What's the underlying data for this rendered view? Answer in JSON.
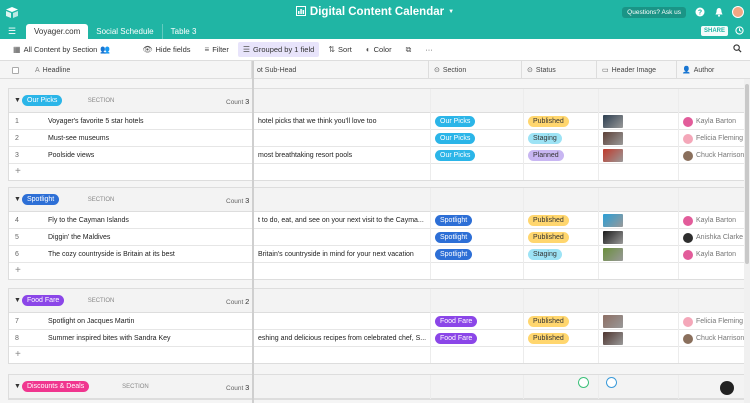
{
  "app": {
    "title": "Digital Content Calendar",
    "help_label": "Questions? Ask us",
    "share_label": "SHARE",
    "brand_color": "#20b5a4"
  },
  "tabs": [
    {
      "label": "Voyager.com",
      "active": true
    },
    {
      "label": "Social Schedule",
      "active": false
    },
    {
      "label": "Table 3",
      "active": false
    }
  ],
  "toolbar": {
    "view_label": "All Content by Section",
    "hide_fields": "Hide fields",
    "filter": "Filter",
    "grouped": "Grouped by 1 field",
    "sort": "Sort",
    "color": "Color",
    "more": "···"
  },
  "columns": {
    "headline": "Headline",
    "subhead": "ot Sub-Head",
    "section": "Section",
    "status": "Status",
    "header_image": "Header Image",
    "author": "Author"
  },
  "groups": [
    {
      "name": "Our Picks",
      "label": "SECTION",
      "count_label": "Count",
      "count": "3",
      "color": "#2bb5e8",
      "rows": [
        {
          "num": "1",
          "headline": "Voyager's favorite 5 star hotels",
          "subhead": "hotel picks that we think you'll love too",
          "status": "Published",
          "author": "Kayla Barton"
        },
        {
          "num": "2",
          "headline": "Must-see museums",
          "subhead": "",
          "status": "Staging",
          "author": "Felicia Fleming"
        },
        {
          "num": "3",
          "headline": "Poolside views",
          "subhead": "most breathtaking resort pools",
          "status": "Planned",
          "author": "Chuck Harrison"
        }
      ]
    },
    {
      "name": "Spotlight",
      "label": "SECTION",
      "count_label": "Count",
      "count": "3",
      "color": "#2d6fd6",
      "rows": [
        {
          "num": "4",
          "headline": "Fly to the Cayman Islands",
          "subhead": "t to do, eat, and see on your next visit to the Cayma...",
          "status": "Published",
          "author": "Kayla Barton"
        },
        {
          "num": "5",
          "headline": "Diggin' the Maldives",
          "subhead": "",
          "status": "Published",
          "author": "Anishka Clarke"
        },
        {
          "num": "6",
          "headline": "The cozy countryside is Britain at its best",
          "subhead": "Britain's countryside in mind for your next vacation",
          "status": "Staging",
          "author": "Kayla Barton"
        }
      ]
    },
    {
      "name": "Food Fare",
      "label": "SECTION",
      "count_label": "Count",
      "count": "2",
      "color": "#8b46e8",
      "rows": [
        {
          "num": "7",
          "headline": "Spotlight on Jacques Martin",
          "subhead": "",
          "status": "Published",
          "author": "Felicia Fleming"
        },
        {
          "num": "8",
          "headline": "Summer inspired bites with Sandra Key",
          "subhead": "eshing and delicious recipes from celebrated chef, S...",
          "status": "Published",
          "author": "Chuck Harrison"
        }
      ]
    },
    {
      "name": "Discounts & Deals",
      "label": "SECTION",
      "count_label": "Count",
      "count": "3",
      "color": "#f0368f",
      "rows": []
    }
  ],
  "status_colors": {
    "Published": "#ffd66e",
    "Staging": "#9de3f5",
    "Planned": "#c8b6f2"
  }
}
